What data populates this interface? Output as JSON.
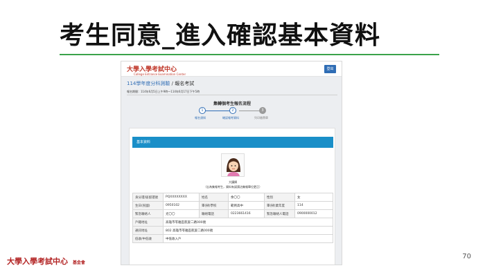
{
  "slide": {
    "title": "考生同意_進入確認基本資料",
    "page_number": "70",
    "footer_logo": "大學入學考試中心",
    "footer_logo_small": "基金會",
    "rule_color": "#3aa24a"
  },
  "screen": {
    "brand": "大學入學考試中心",
    "brand_en": "College Entrance Examination Center",
    "logout_label": "登出",
    "breadcrumb": {
      "root": "114學年度分科測驗",
      "sep": "/",
      "current": "報名考試"
    },
    "period": "報名期間：114年6月5日上午9時～114年6月17日下午5時",
    "flow_title": "集轉個考生報名流程",
    "steps": [
      {
        "num": "1",
        "label": "報名須知",
        "state": "done"
      },
      {
        "num": "2",
        "label": "確認報考資料",
        "state": "done"
      },
      {
        "num": "3",
        "label": "列印繳費單",
        "state": "todo"
      }
    ],
    "card_title": "基本資料",
    "student_name": "大鐘鍋",
    "photo_note": "（忘為集報考生，資料有誤請洽集報單位更正）",
    "table": {
      "row1": [
        "身分證/居留證號",
        "PQXXXXXXXX",
        "姓名",
        "余〇〇",
        "性別",
        "女"
      ],
      "row2": [
        "生日(民國)",
        "0950102",
        "畢(肄)學校",
        "範例高中",
        "畢(肄)業年度",
        "114"
      ],
      "row3": [
        "緊急聯絡人",
        "尤〇〇",
        "聯絡電話",
        "0223661416",
        "緊急聯絡人電話",
        "0900000012"
      ],
      "row4": [
        "戶籍地址",
        "高雄市苓雅區凱旋二路000號"
      ],
      "row5": [
        "通訊地址",
        "802 高雄市苓雅區凱旋二路000號"
      ],
      "row6": [
        "低收/中低收",
        "中低收入戶"
      ]
    },
    "colors": {
      "accent": "#2f6db5",
      "card_head": "#1a8fc8",
      "brand": "#c0392b"
    }
  }
}
